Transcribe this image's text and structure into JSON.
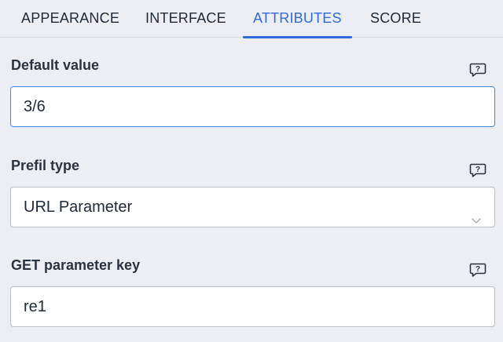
{
  "tabs": [
    {
      "label": "APPEARANCE",
      "active": false
    },
    {
      "label": "INTERFACE",
      "active": false
    },
    {
      "label": "ATTRIBUTES",
      "active": true
    },
    {
      "label": "SCORE",
      "active": false
    }
  ],
  "fields": {
    "default_value": {
      "label": "Default value",
      "value": "3/6",
      "help_icon": "speech-bubble-question-icon"
    },
    "prefil_type": {
      "label": "Prefil type",
      "selected": "URL Parameter",
      "help_icon": "speech-bubble-question-icon",
      "dropdown_icon": "chevron-down-icon"
    },
    "get_parameter_key": {
      "label": "GET parameter key",
      "value": "re1",
      "help_icon": "speech-bubble-question-icon"
    }
  },
  "colors": {
    "accent": "#2f6bdc",
    "background": "#eceef4",
    "focus_border": "#4a86e0"
  }
}
